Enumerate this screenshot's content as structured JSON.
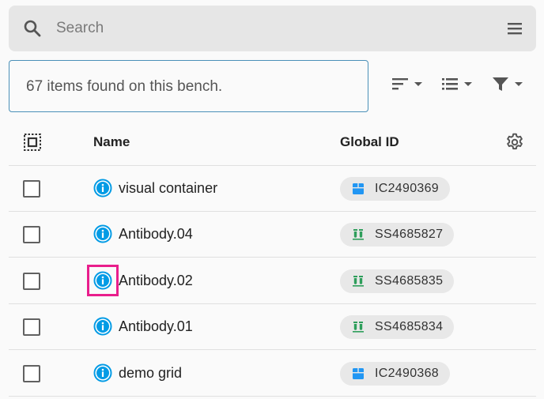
{
  "search": {
    "placeholder": "Search"
  },
  "status": {
    "text": "67 items found on this bench."
  },
  "table": {
    "columns": {
      "name": "Name",
      "global_id": "Global ID"
    },
    "rows": [
      {
        "name": "visual container",
        "global_id": "IC2490369",
        "type_icon": "container-icon"
      },
      {
        "name": "Antibody.04",
        "global_id": "SS4685827",
        "type_icon": "sample-tubes-icon"
      },
      {
        "name": "Antibody.02",
        "global_id": "SS4685835",
        "type_icon": "sample-tubes-icon"
      },
      {
        "name": "Antibody.01",
        "global_id": "SS4685834",
        "type_icon": "sample-tubes-icon"
      },
      {
        "name": "demo grid",
        "global_id": "IC2490368",
        "type_icon": "container-icon"
      }
    ]
  },
  "colors": {
    "info_icon": "#039be5",
    "container_icon": "#2196f3",
    "sample_icon": "#2e9e5b",
    "highlight": "#e91e8c"
  }
}
